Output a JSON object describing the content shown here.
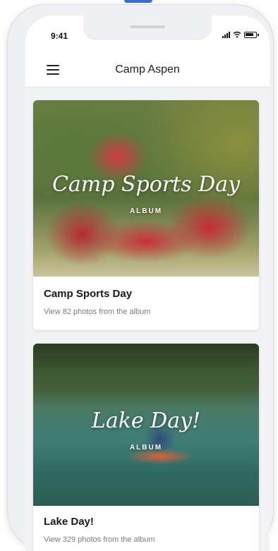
{
  "status_bar": {
    "time": "9:41",
    "icons": [
      "signal-icon",
      "wifi-icon",
      "battery-icon"
    ]
  },
  "nav": {
    "title": "Camp Aspen",
    "menu_icon": "hamburger-menu-icon"
  },
  "albums": [
    {
      "cover_title": "Camp Sports Day",
      "cover_tag": "ALBUM",
      "title": "Camp Sports Day",
      "description": "View 82 photos from the album"
    },
    {
      "cover_title": "Lake Day!",
      "cover_tag": "ALBUM",
      "title": "Lake Day!",
      "description": "View 329 photos from the album"
    }
  ],
  "colors": {
    "accent": "#3a6fd8",
    "text_primary": "#1a1a1a",
    "text_secondary": "#7a7d82",
    "background": "#f1f2f4"
  }
}
